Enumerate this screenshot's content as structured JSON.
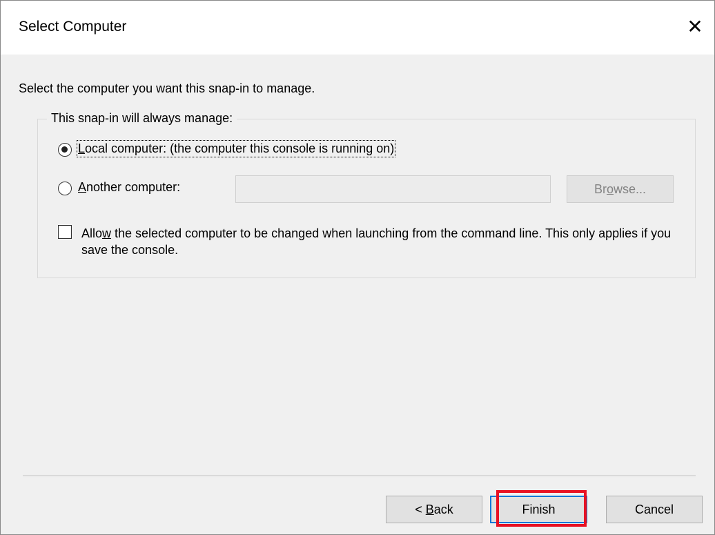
{
  "window": {
    "title": "Select Computer",
    "close_glyph": "✕"
  },
  "intro_text": "Select the computer you want this snap-in to manage.",
  "group": {
    "legend": "This snap-in will always manage:",
    "local_option": {
      "label_prefix": "",
      "label_accel": "L",
      "label_rest": "ocal computer:  (the computer this console is running on)",
      "selected": true
    },
    "another_option": {
      "label_accel": "A",
      "label_rest": "nother computer:",
      "selected": false
    },
    "computer_name_value": "",
    "browse_button": {
      "label_pre": "Br",
      "label_accel": "o",
      "label_post": "wse...",
      "enabled": false
    },
    "allow_change": {
      "label_pre": "Allo",
      "label_accel": "w",
      "label_post": " the selected computer to be changed when launching from the command line.  This only applies if you save the console.",
      "checked": false
    }
  },
  "footer": {
    "back_prefix": "< ",
    "back_accel": "B",
    "back_rest": "ack",
    "finish_label": "Finish",
    "cancel_label": "Cancel"
  },
  "colors": {
    "focus_border": "#0078d7",
    "annotation_highlight": "#e81123"
  }
}
